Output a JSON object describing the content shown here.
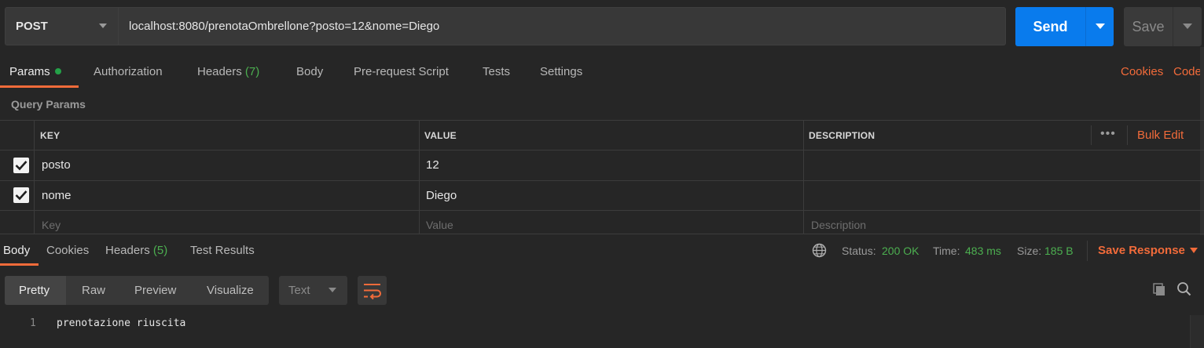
{
  "request": {
    "method": "POST",
    "url": "localhost:8080/prenotaOmbrellone?posto=12&nome=Diego",
    "send_label": "Send",
    "save_label": "Save"
  },
  "request_tabs": [
    {
      "label": "Params",
      "active": true
    },
    {
      "label": "Authorization"
    },
    {
      "label": "Headers",
      "count": "(7)"
    },
    {
      "label": "Body"
    },
    {
      "label": "Pre-request Script"
    },
    {
      "label": "Tests"
    },
    {
      "label": "Settings"
    }
  ],
  "links": {
    "cookies": "Cookies",
    "code": "Code"
  },
  "query_params": {
    "section_label": "Query Params",
    "columns": {
      "key": "KEY",
      "value": "VALUE",
      "description": "DESCRIPTION"
    },
    "bulk_edit": "Bulk Edit",
    "rows": [
      {
        "checked": true,
        "key": "posto",
        "value": "12",
        "description": ""
      },
      {
        "checked": true,
        "key": "nome",
        "value": "Diego",
        "description": ""
      }
    ],
    "placeholders": {
      "key": "Key",
      "value": "Value",
      "description": "Description"
    }
  },
  "response": {
    "tabs": [
      {
        "label": "Body",
        "active": true
      },
      {
        "label": "Cookies"
      },
      {
        "label": "Headers",
        "count": "(5)"
      },
      {
        "label": "Test Results"
      }
    ],
    "status_label": "Status:",
    "status_value": "200 OK",
    "time_label": "Time:",
    "time_value": "483 ms",
    "size_label": "Size:",
    "size_value": "185 B",
    "save_response": "Save Response",
    "view_modes": [
      "Pretty",
      "Raw",
      "Preview",
      "Visualize"
    ],
    "format": "Text",
    "body_lines": [
      {
        "num": "1",
        "text": "prenotazione riuscita"
      }
    ]
  },
  "colors": {
    "accent": "#f26b3a",
    "send": "#097bed",
    "success": "#4caf50"
  }
}
